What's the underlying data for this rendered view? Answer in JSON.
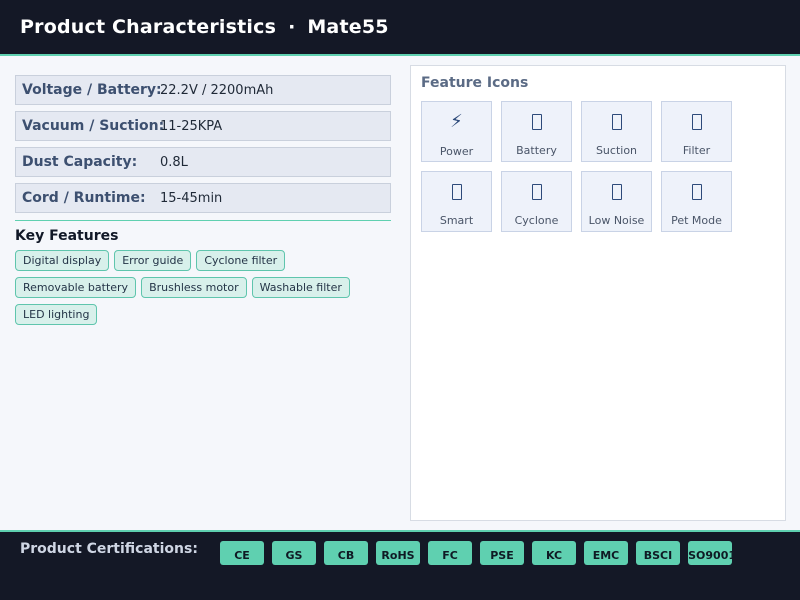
{
  "header": {
    "title": "Product Characteristics",
    "separator": "·",
    "model": "Mate55"
  },
  "specs": [
    {
      "label": "Voltage / Battery:",
      "value": "22.2V / 2200mAh"
    },
    {
      "label": "Vacuum / Suction:",
      "value": "11-25KPA"
    },
    {
      "label": "Dust Capacity:",
      "value": "0.8L"
    },
    {
      "label": "Cord / Runtime:",
      "value": "15-45min"
    }
  ],
  "key_features": {
    "title": "Key Features",
    "items": [
      "Digital display",
      "Error guide",
      "Cyclone filter",
      "Removable battery",
      "Brushless motor",
      "Washable filter",
      "LED lighting"
    ]
  },
  "feature_icons": {
    "title": "Feature Icons",
    "items": [
      {
        "label": "Power",
        "icon": "lightning-icon",
        "glyph": "⚡"
      },
      {
        "label": "Battery",
        "icon": "battery-icon",
        "glyph": ""
      },
      {
        "label": "Suction",
        "icon": "suction-icon",
        "glyph": ""
      },
      {
        "label": "Filter",
        "icon": "filter-icon",
        "glyph": ""
      },
      {
        "label": "Smart",
        "icon": "smart-icon",
        "glyph": ""
      },
      {
        "label": "Cyclone",
        "icon": "cyclone-icon",
        "glyph": ""
      },
      {
        "label": "Low Noise",
        "icon": "low-noise-icon",
        "glyph": ""
      },
      {
        "label": "Pet Mode",
        "icon": "pet-mode-icon",
        "glyph": ""
      }
    ]
  },
  "certifications": {
    "title": "Product Certifications:",
    "items": [
      "CE",
      "GS",
      "CB",
      "RoHS",
      "FC",
      "PSE",
      "KC",
      "EMC",
      "BSCI",
      "ISO9001"
    ]
  },
  "colors": {
    "header_bg": "#141826",
    "accent": "#5fd0b0",
    "label": "#3d5070"
  }
}
